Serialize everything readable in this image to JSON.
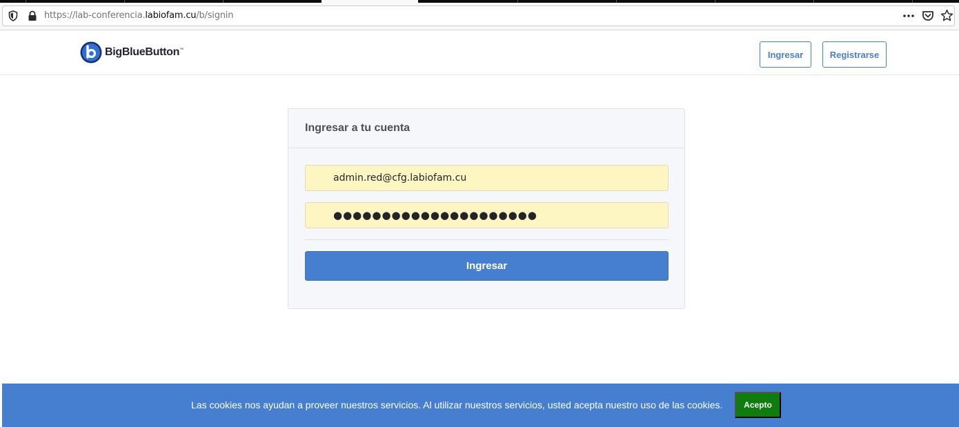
{
  "browser": {
    "url_prefix": "https://lab-conferencia.",
    "url_host": "labiofam.cu",
    "url_suffix": "/b/signin"
  },
  "header": {
    "logo_text": "BigBlueButton",
    "logo_tm": "™",
    "signin_label": "Ingresar",
    "signup_label": "Registrarse"
  },
  "login": {
    "title": "Ingresar a tu cuenta",
    "email_value": "admin.red@cfg.labiofam.cu",
    "password_mask": "●●●●●●●●●●●●●●●●●●●●●",
    "submit_label": "Ingresar"
  },
  "cookie": {
    "message": "Las cookies nos ayudan a proveer nuestros servicios. Al utilizar nuestros servicios, usted acepta nuestro uso de las cookies.",
    "accept_label": "Acepto"
  },
  "colors": {
    "accent": "#467fcf",
    "autofill": "#fdf6c3",
    "accept_green": "#0e7d0e"
  },
  "icons": [
    "shield-icon",
    "lock-icon",
    "page-actions-icon",
    "pocket-icon",
    "bookmark-star-icon",
    "bigbluebutton-logo-icon"
  ]
}
